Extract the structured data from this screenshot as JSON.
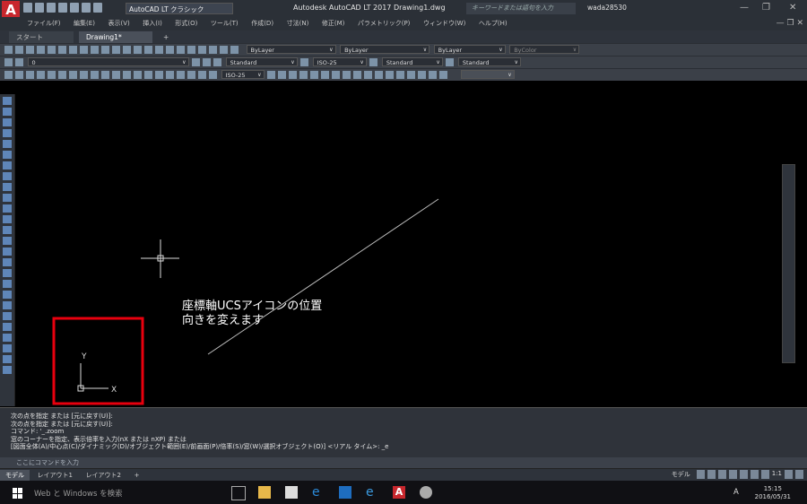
{
  "app": {
    "logo_letter": "A",
    "workspace": "AutoCAD LT クラシック",
    "title": "Autodesk AutoCAD LT 2017   Drawing1.dwg",
    "search_placeholder": "キーワードまたは語句を入力",
    "user": "wada28530"
  },
  "menu": {
    "items": [
      "ファイル(F)",
      "編集(E)",
      "表示(V)",
      "挿入(I)",
      "形式(O)",
      "ツール(T)",
      "作成(D)",
      "寸法(N)",
      "修正(M)",
      "パラメトリック(P)",
      "ウィンドウ(W)",
      "ヘルプ(H)"
    ]
  },
  "file_tabs": [
    "スタート",
    "Drawing1*",
    "+"
  ],
  "toolbars": {
    "layer_name": "0",
    "bylayer_color": "ByLayer",
    "bylayer_linetype": "ByLayer",
    "bylayer_lineweight": "ByLayer",
    "bycolor": "ByColor",
    "text_style": "Standard",
    "dim_style": "ISO-25",
    "table_style": "Standard",
    "mleader_style": "Standard",
    "dim_style_2": "ISO-25"
  },
  "canvas": {
    "annotation_line1": "座標軸UCSアイコンの位置",
    "annotation_line2": "向きを変えます",
    "ucs_y": "Y",
    "ucs_x": "X",
    "highlight_color": "#e8000e"
  },
  "command": {
    "history": [
      "次の点を指定 または [元に戻す(U)]:",
      "次の点を指定 または [元に戻す(U)]:",
      "コマンド: '_.zoom",
      "窓のコーナーを指定、表示倍率を入力(nX または nXP) または",
      "[図面全体(A)/中心点(C)/ダイナミック(D)/オブジェクト範囲(E)/前画面(P)/倍率(S)/窓(W)/選択オブジェクト(O)] <リアル タイム>: _e"
    ],
    "input_placeholder": "ここにコマンドを入力"
  },
  "layout_tabs": [
    "モデル",
    "レイアウト1",
    "レイアウト2",
    "+"
  ],
  "status": {
    "model": "モデル",
    "scale": "1:1"
  },
  "taskbar": {
    "search_text": "Web と Windows を検索",
    "time": "15:15",
    "date": "2016/05/31",
    "ime": "A"
  }
}
